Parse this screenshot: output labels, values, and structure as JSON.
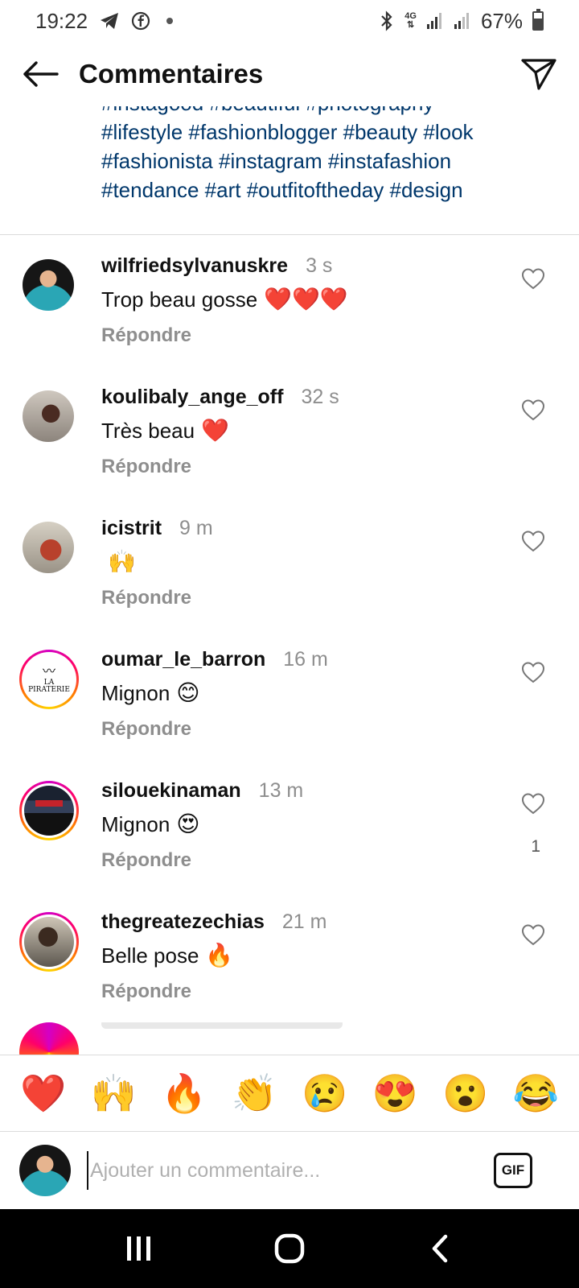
{
  "status_bar": {
    "time": "19:22",
    "network": "4G",
    "battery": "67%",
    "battery_level": 0.67,
    "icons": [
      "telegram-icon",
      "facebook-icon",
      "dot-icon",
      "bluetooth-icon",
      "signal-icon",
      "signal-icon"
    ]
  },
  "header": {
    "title": "Commentaires",
    "back_icon": "arrow-left-icon",
    "share_icon": "paper-plane-icon"
  },
  "caption": {
    "lines": [
      "#instagood #beautiful #photography",
      "#lifestyle #fashionblogger #beauty #look",
      "#fashionista #instagram #instafashion",
      "#tendance #art #outfitoftheday #design"
    ],
    "color": "#00376b"
  },
  "comments": [
    {
      "username": "wilfriedsylvanuskre",
      "time": "3 s",
      "text": "Trop beau gosse",
      "emoji": "❤️❤️❤️",
      "reply": "Répondre",
      "likes": "",
      "story_ring": false
    },
    {
      "username": "koulibaly_ange_off",
      "time": "32 s",
      "text": "Très beau",
      "emoji": "❤️",
      "reply": "Répondre",
      "likes": "",
      "story_ring": false
    },
    {
      "username": "icistrit",
      "time": "9 m",
      "text": "",
      "emoji": "🙌",
      "reply": "Répondre",
      "likes": "",
      "story_ring": false
    },
    {
      "username": "oumar_le_barron",
      "time": "16 m",
      "text": "Mignon",
      "emoji": "😊",
      "reply": "Répondre",
      "likes": "",
      "story_ring": true,
      "avatar_text": "LA PIRATERIE"
    },
    {
      "username": "silouekinaman",
      "time": "13 m",
      "text": "Mignon",
      "emoji": "😍",
      "reply": "Répondre",
      "likes": "1",
      "story_ring": true
    },
    {
      "username": "thegreatezechias",
      "time": "21 m",
      "text": "Belle pose",
      "emoji": "🔥",
      "reply": "Répondre",
      "likes": "",
      "story_ring": true
    }
  ],
  "reactions": [
    "❤️",
    "🙌",
    "🔥",
    "👏",
    "😢",
    "😍",
    "😮",
    "😂"
  ],
  "composer": {
    "placeholder": "Ajouter un commentaire...",
    "gif_label": "GIF"
  },
  "colors": {
    "hashtag": "#00376b",
    "muted": "#8e8e8e",
    "heart_red": "#ed4956"
  }
}
